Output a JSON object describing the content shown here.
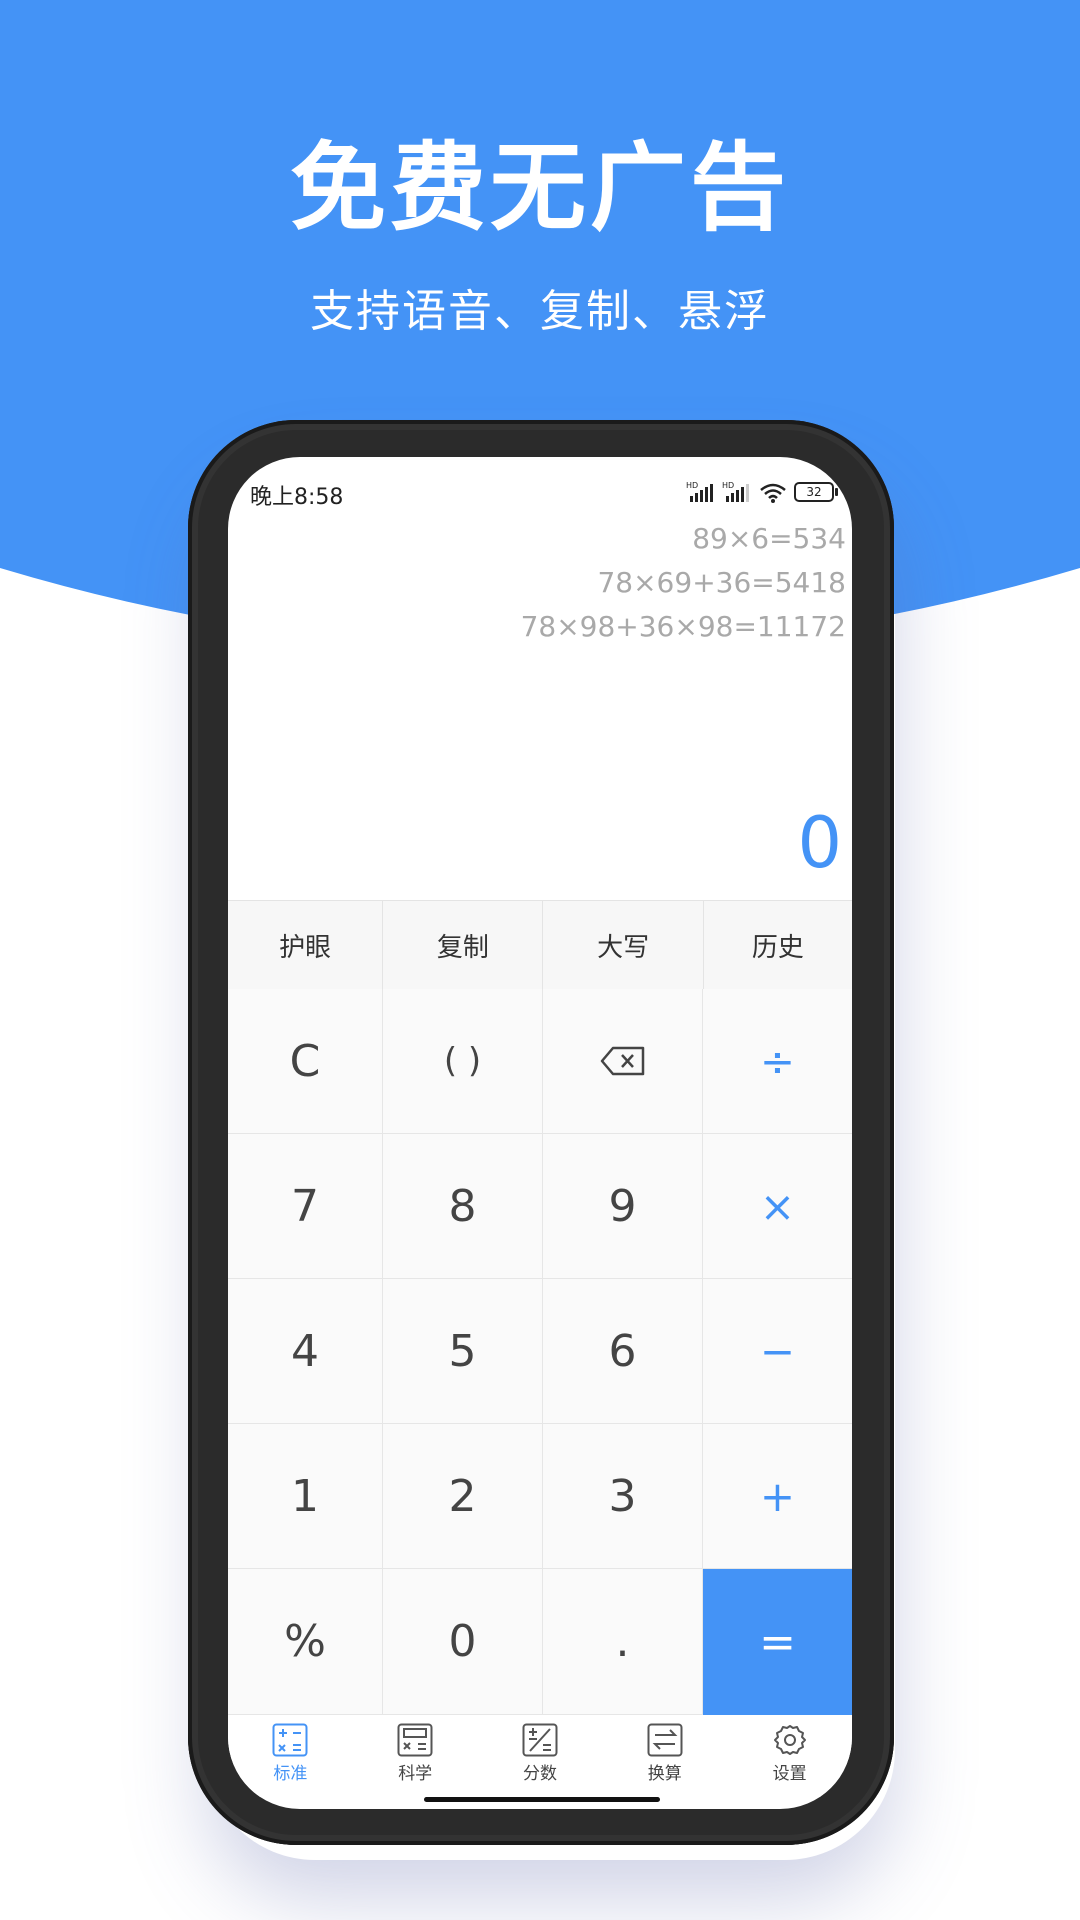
{
  "banner": {
    "title": "免费无广告",
    "subtitle": "支持语音、复制、悬浮",
    "color": "#4493f6"
  },
  "status_bar": {
    "time": "晚上8:58",
    "battery": "32",
    "hd1": "HD",
    "hd2": "HD"
  },
  "display": {
    "history": [
      "89×6=534",
      "78×69+36=5418",
      "78×98+36×98=11172"
    ],
    "result": "0"
  },
  "toolbar": {
    "items": [
      "护眼",
      "复制",
      "大写",
      "历史"
    ]
  },
  "keypad": {
    "clear": "C",
    "parens": "( )",
    "backspace_icon": "backspace-icon",
    "divide": "÷",
    "k7": "7",
    "k8": "8",
    "k9": "9",
    "multiply": "×",
    "k4": "4",
    "k5": "5",
    "k6": "6",
    "minus": "−",
    "k1": "1",
    "k2": "2",
    "k3": "3",
    "plus": "+",
    "percent": "%",
    "k0": "0",
    "dot": ".",
    "equals": "="
  },
  "tabs": [
    {
      "label": "标准",
      "icon": "standard-calc-icon",
      "active": true
    },
    {
      "label": "科学",
      "icon": "scientific-calc-icon",
      "active": false
    },
    {
      "label": "分数",
      "icon": "fraction-icon",
      "active": false
    },
    {
      "label": "换算",
      "icon": "convert-icon",
      "active": false
    },
    {
      "label": "设置",
      "icon": "gear-icon",
      "active": false
    }
  ]
}
